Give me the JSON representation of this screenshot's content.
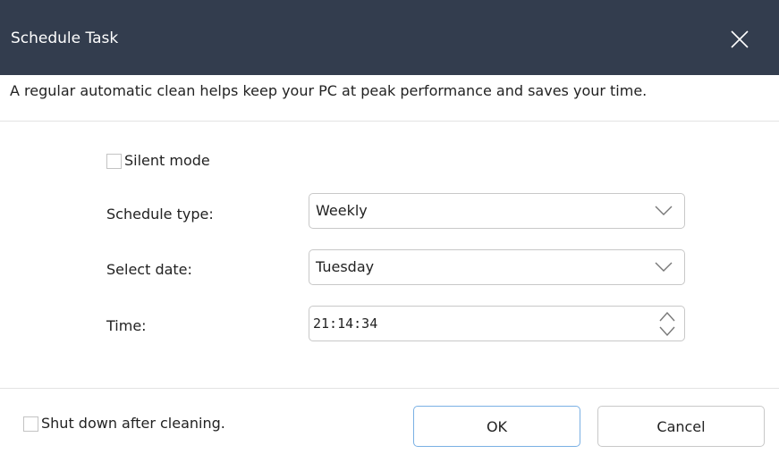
{
  "window": {
    "title": "Schedule Task",
    "close_icon": "close-icon"
  },
  "description": "A regular automatic clean helps keep your PC at peak performance and saves your time.",
  "silent_mode": {
    "label": "Silent mode",
    "checked": false
  },
  "schedule_type": {
    "label": "Schedule type:",
    "value": "Weekly"
  },
  "select_date": {
    "label": "Select date:",
    "value": "Tuesday"
  },
  "time": {
    "label": "Time:",
    "value": "21:14:34"
  },
  "shutdown": {
    "label": "Shut down after cleaning.",
    "checked": false
  },
  "buttons": {
    "ok": "OK",
    "cancel": "Cancel"
  },
  "colors": {
    "titlebar": "#333d4e",
    "ok_border": "#7ab0e4"
  }
}
